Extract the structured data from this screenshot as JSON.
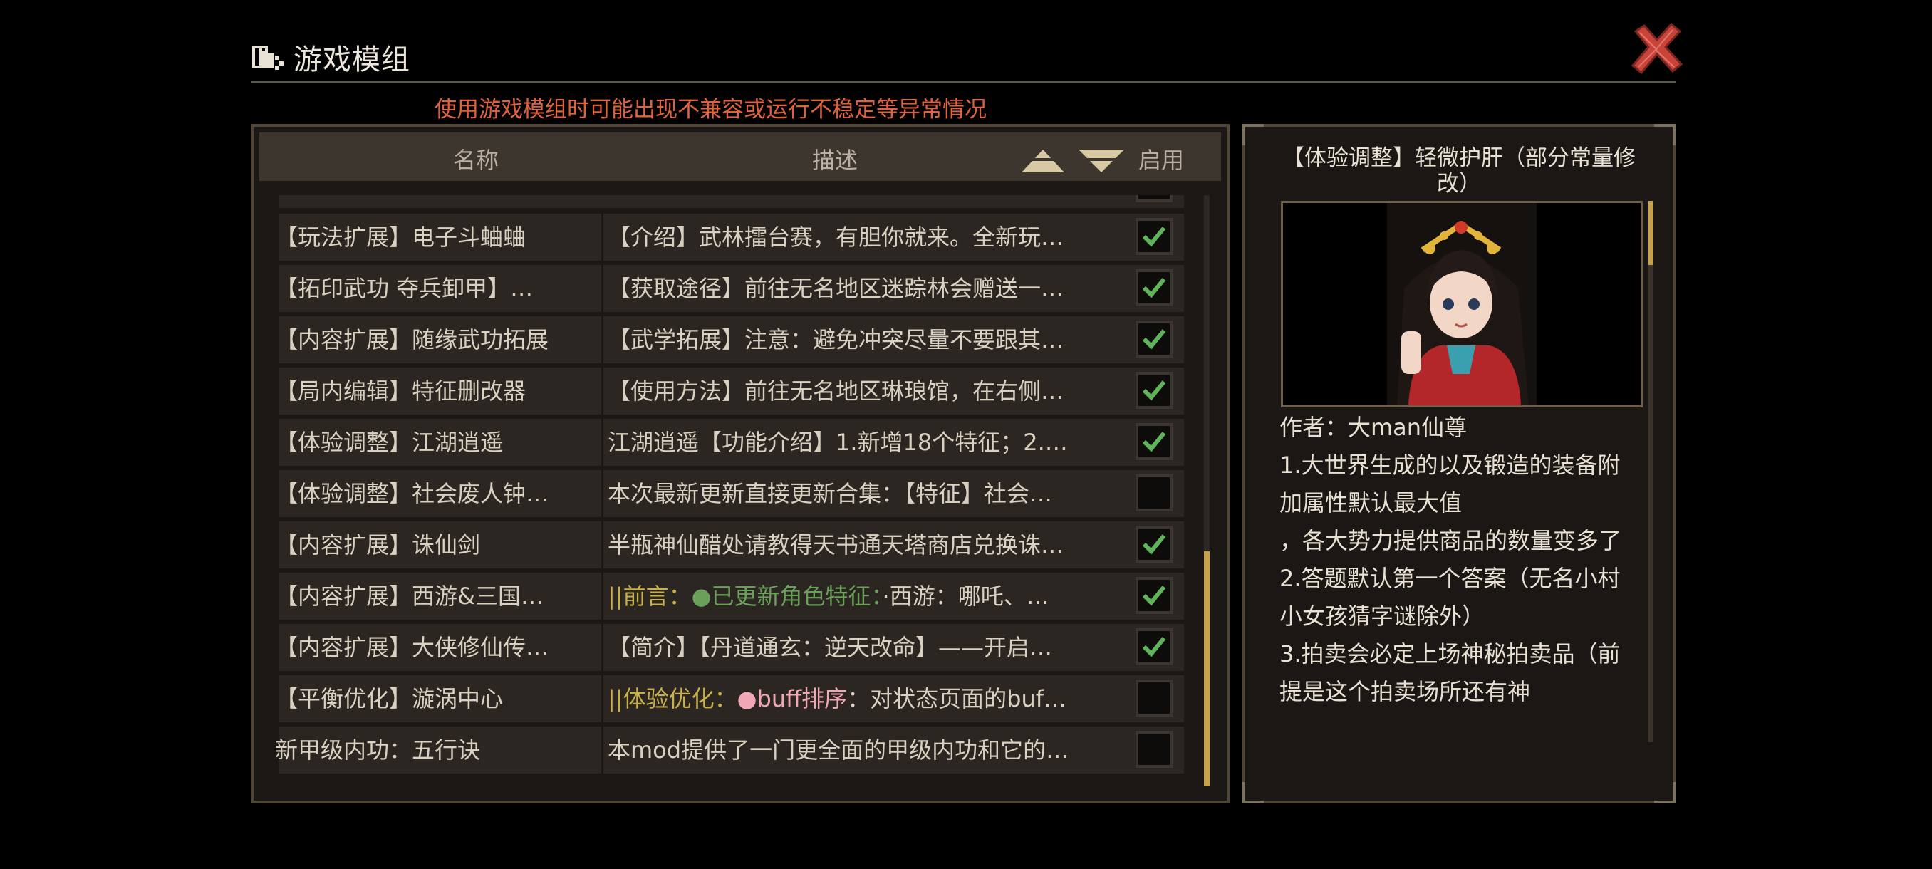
{
  "header": {
    "title": "游戏模组",
    "warning": "使用游戏模组时可能出现不兼容或运行不稳定等异常情况"
  },
  "columns": {
    "name": "名称",
    "desc": "描述",
    "enable": "启用"
  },
  "mods": [
    {
      "name": "【玩法扩展】电子斗蛐蛐",
      "desc": "【介绍】武林擂台赛，有胆你就来。全新玩…",
      "enabled": true
    },
    {
      "name": "【拓印武功 夺兵卸甲】…",
      "desc": "【获取途径】前往无名地区迷踪林会赠送一…",
      "enabled": true
    },
    {
      "name": "【内容扩展】随缘武功拓展",
      "desc": "【武学拓展】注意：避免冲突尽量不要跟其…",
      "enabled": true
    },
    {
      "name": "【局内编辑】特征删改器",
      "desc": "【使用方法】前往无名地区琳琅馆，在右侧…",
      "enabled": true
    },
    {
      "name": "【体验调整】江湖逍遥",
      "desc": "江湖逍遥【功能介绍】1.新增18个特征；2.…",
      "enabled": true
    },
    {
      "name": "【体验调整】社会废人钟…",
      "desc": "本次最新更新直接更新合集：【特征】社会…",
      "enabled": false
    },
    {
      "name": "【内容扩展】诛仙剑",
      "desc": "半瓶神仙醋处请教得天书通天塔商店兑换诛…",
      "enabled": true
    },
    {
      "name": "【内容扩展】西游&三国…",
      "desc_parts": [
        "||前言：",
        "●已更新角色特征：",
        "·西游：哪吒、…"
      ],
      "enabled": true
    },
    {
      "name": "【内容扩展】大侠修仙传…",
      "desc": "【简介】【丹道通玄：逆天改命】——开启…",
      "enabled": true
    },
    {
      "name": "【平衡优化】漩涡中心",
      "desc_parts": [
        "||体验优化：",
        "●",
        "buff排序",
        "：对状态页面的buf…"
      ],
      "enabled": false
    },
    {
      "name": "新甲级内功：五行诀",
      "desc": "本mod提供了一门更全面的甲级内功和它的…",
      "enabled": false
    }
  ],
  "detail": {
    "title": "【体验调整】轻微护肝（部分常量修改）",
    "author": "作者：大man仙尊",
    "lines": [
      "1.大世界生成的以及锻造的装备附加属性默认最大值",
      "，各大势力提供商品的数量变多了",
      "2.答题默认第一个答案（无名小村小女孩猜字谜除外）",
      "3.拍卖会必定上场神秘拍卖品（前提是这个拍卖场所还有神"
    ]
  },
  "colors": {
    "warning": "#e0623c",
    "check": "#5fb45a",
    "accent_gold": "#c8a24a"
  },
  "icons": [
    "mod-icon",
    "close-icon",
    "sort-up-icon",
    "sort-down-icon",
    "check-icon"
  ]
}
